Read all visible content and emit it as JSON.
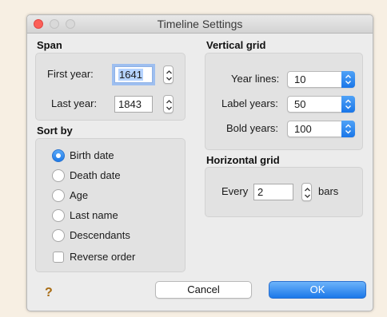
{
  "window": {
    "title": "Timeline Settings"
  },
  "span": {
    "heading": "Span",
    "first_year_label": "First year:",
    "first_year_value": "1641",
    "last_year_label": "Last year:",
    "last_year_value": "1843"
  },
  "sort_by": {
    "heading": "Sort by",
    "options": [
      {
        "label": "Birth date",
        "selected": true
      },
      {
        "label": "Death date",
        "selected": false
      },
      {
        "label": "Age",
        "selected": false
      },
      {
        "label": "Last name",
        "selected": false
      },
      {
        "label": "Descendants",
        "selected": false
      }
    ],
    "reverse_label": "Reverse order",
    "reverse_checked": false
  },
  "vertical_grid": {
    "heading": "Vertical grid",
    "year_lines_label": "Year lines:",
    "year_lines_value": "10",
    "label_years_label": "Label years:",
    "label_years_value": "50",
    "bold_years_label": "Bold years:",
    "bold_years_value": "100"
  },
  "horizontal_grid": {
    "heading": "Horizontal grid",
    "every_label": "Every",
    "every_value": "2",
    "bars_label": "bars"
  },
  "footer": {
    "help_glyph": "?",
    "cancel_label": "Cancel",
    "ok_label": "OK"
  },
  "colors": {
    "accent": "#1b78e9",
    "help": "#a86b12",
    "close_button": "#fc5f57"
  }
}
